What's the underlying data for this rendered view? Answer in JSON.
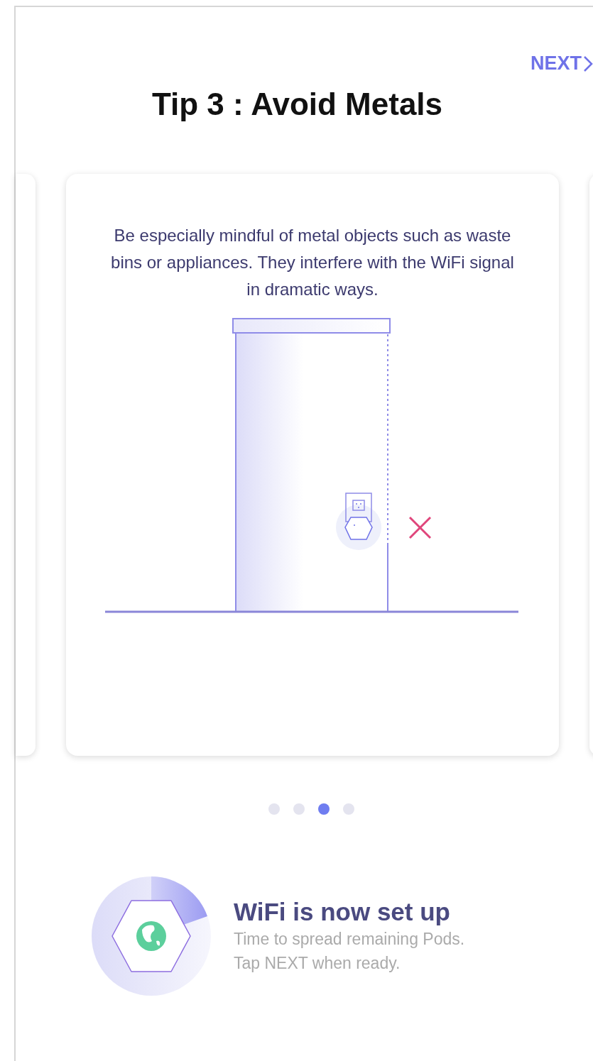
{
  "next_button": {
    "label": "NEXT"
  },
  "title": "Tip 3 : Avoid Metals",
  "tip_card": {
    "description": "Be especially mindful of metal objects such as waste bins or appliances. They interfere with the WiFi signal in dramatic ways."
  },
  "pager_dots": [
    {
      "selected": false
    },
    {
      "selected": false
    },
    {
      "selected": true
    },
    {
      "selected": false
    }
  ],
  "status": {
    "title": "WiFi is now set up",
    "lines": [
      "Time to spread remaining Pods.",
      "Tap NEXT when ready."
    ]
  }
}
